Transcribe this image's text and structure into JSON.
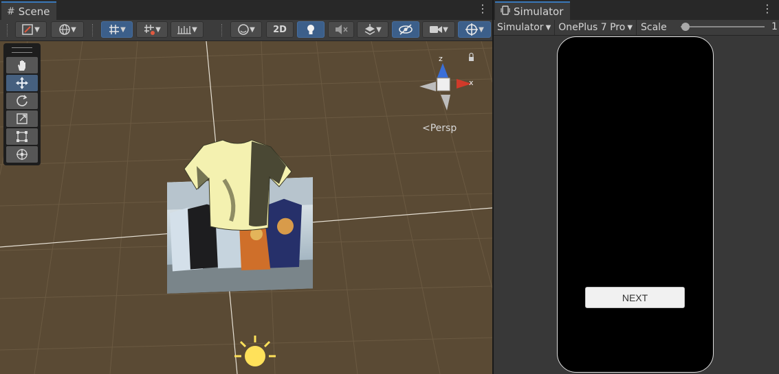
{
  "scene": {
    "tab_title": "Scene",
    "tab_icon": "hash-icon",
    "toolbar": {
      "mode_2d_label": "2D"
    },
    "view_mode_label": "Persp",
    "gizmo_axes": {
      "z": "z",
      "x": "x"
    }
  },
  "simulator": {
    "tab_title": "Simulator",
    "tab_icon": "phone-icon",
    "mode_dropdown": "Simulator",
    "device_dropdown": "OnePlus 7 Pro",
    "scale_label": "Scale",
    "scale_value": "1",
    "next_button_label": "NEXT"
  },
  "colors": {
    "accent": "#3a79bb",
    "viewport_bg": "#5a4a34",
    "panel_bg": "#383838",
    "axis_x": "#d03a2a",
    "axis_z": "#3a6fd8",
    "sun": "#ffe15a"
  }
}
